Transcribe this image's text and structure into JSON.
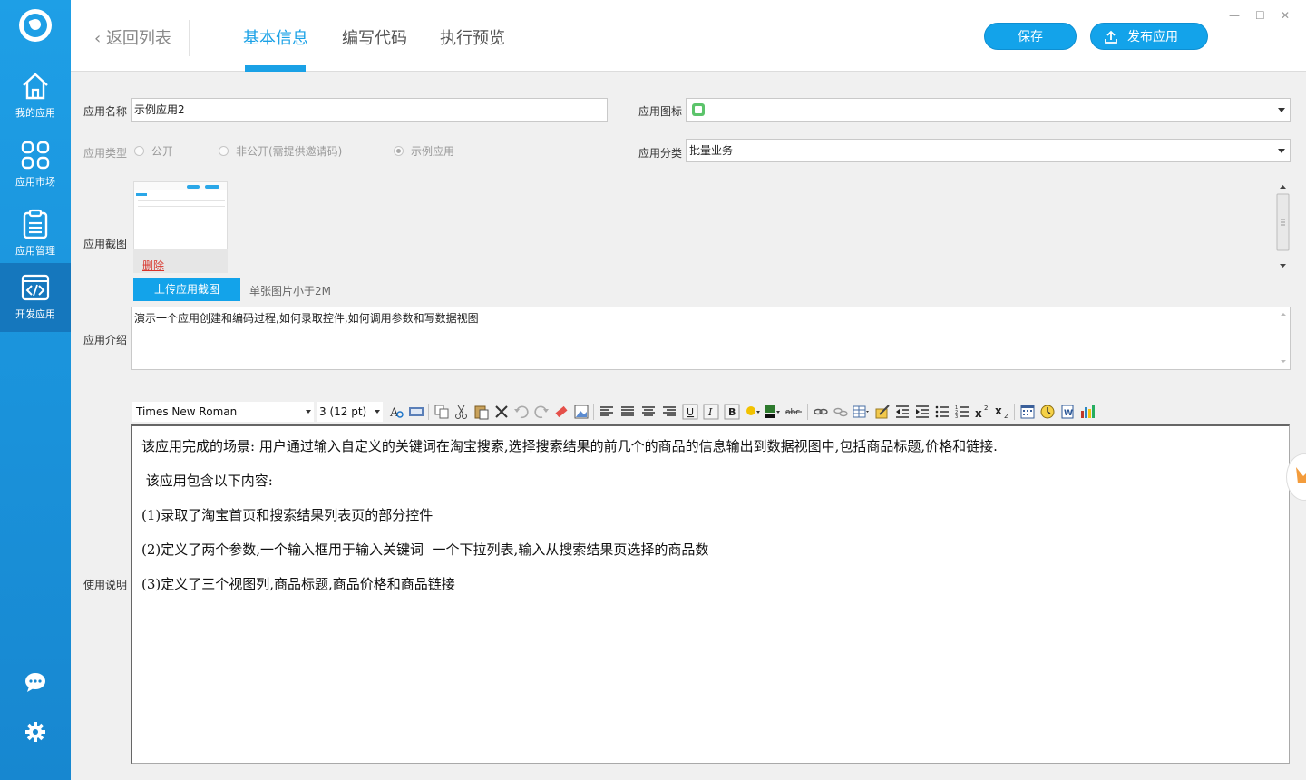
{
  "sidebar": {
    "items": [
      {
        "label": "我的应用",
        "icon": "home-icon"
      },
      {
        "label": "应用市场",
        "icon": "grid-icon"
      },
      {
        "label": "应用管理",
        "icon": "clipboard-icon"
      },
      {
        "label": "开发应用",
        "icon": "code-window-icon"
      }
    ],
    "active_index": 3
  },
  "header": {
    "back_label": "返回列表",
    "tabs": [
      {
        "label": "基本信息"
      },
      {
        "label": "编写代码"
      },
      {
        "label": "执行预览"
      }
    ],
    "active_tab": 0,
    "save_label": "保存",
    "publish_label": "发布应用"
  },
  "form": {
    "name_label": "应用名称",
    "name_value": "示例应用2",
    "icon_label": "应用图标",
    "type_label": "应用类型",
    "type_options": [
      "公开",
      "非公开(需提供邀请码)",
      "示例应用"
    ],
    "type_selected": 2,
    "category_label": "应用分类",
    "category_value": "批量业务",
    "screenshot_label": "应用截图",
    "delete_label": "删除",
    "upload_label": "上传应用截图",
    "upload_hint": "单张图片小于2M",
    "intro_label": "应用介绍",
    "intro_value": "演示一个应用创建和编码过程,如何录取控件,如何调用参数和写数据视图",
    "usage_label": "使用说明"
  },
  "editor": {
    "font_family": "Times New Roman",
    "font_size": "3 (12 pt)",
    "paragraphs": [
      "该应用完成的场景: 用户通过输入自定义的关键词在淘宝搜索,选择搜索结果的前几个的商品的信息输出到数据视图中,包括商品标题,价格和链接.",
      " 该应用包含以下内容:",
      "(1)录取了淘宝首页和搜索结果列表页的部分控件",
      "(2)定义了两个参数,一个输入框用于输入关键词  一个下拉列表,输入从搜索结果页选择的商品数",
      "(3)定义了三个视图列,商品标题,商品价格和商品链接"
    ]
  },
  "colors": {
    "accent": "#13a3ea",
    "sidebar": "#1e9fe6",
    "delete": "#d9342b"
  }
}
